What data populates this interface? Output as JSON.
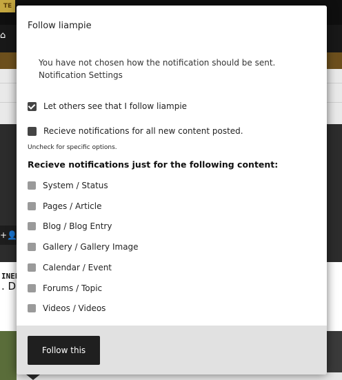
{
  "background": {
    "logo_text": "TE",
    "home_glyph": "⌂",
    "user_button_glyph": "+👤",
    "text_line1": "INED",
    "text_line2": ". De"
  },
  "modal": {
    "title": "Follow liampie",
    "notice": "You have not chosen how the notification should be sent. Notification Settings",
    "options": [
      {
        "label": "Let others see that I follow liampie",
        "checked": true
      },
      {
        "label": "Recieve notifications for all new content posted.",
        "checked": false
      }
    ],
    "hint": "Uncheck for specific options.",
    "section_heading": "Recieve notifications just for the following content:",
    "content_types": [
      {
        "label": "System / Status",
        "checked": false
      },
      {
        "label": "Pages / Article",
        "checked": false
      },
      {
        "label": "Blog / Blog Entry",
        "checked": false
      },
      {
        "label": "Gallery / Gallery Image",
        "checked": false
      },
      {
        "label": "Calendar / Event",
        "checked": false
      },
      {
        "label": "Forums / Topic",
        "checked": false
      },
      {
        "label": "Videos / Videos",
        "checked": false
      }
    ],
    "follow_button": "Follow this"
  },
  "colors": {
    "button_bg": "#1f1f1f",
    "footer_bg": "#e1e1e1",
    "checkbox_gray": "#9a9a9a",
    "checkbox_dark": "#444444"
  }
}
